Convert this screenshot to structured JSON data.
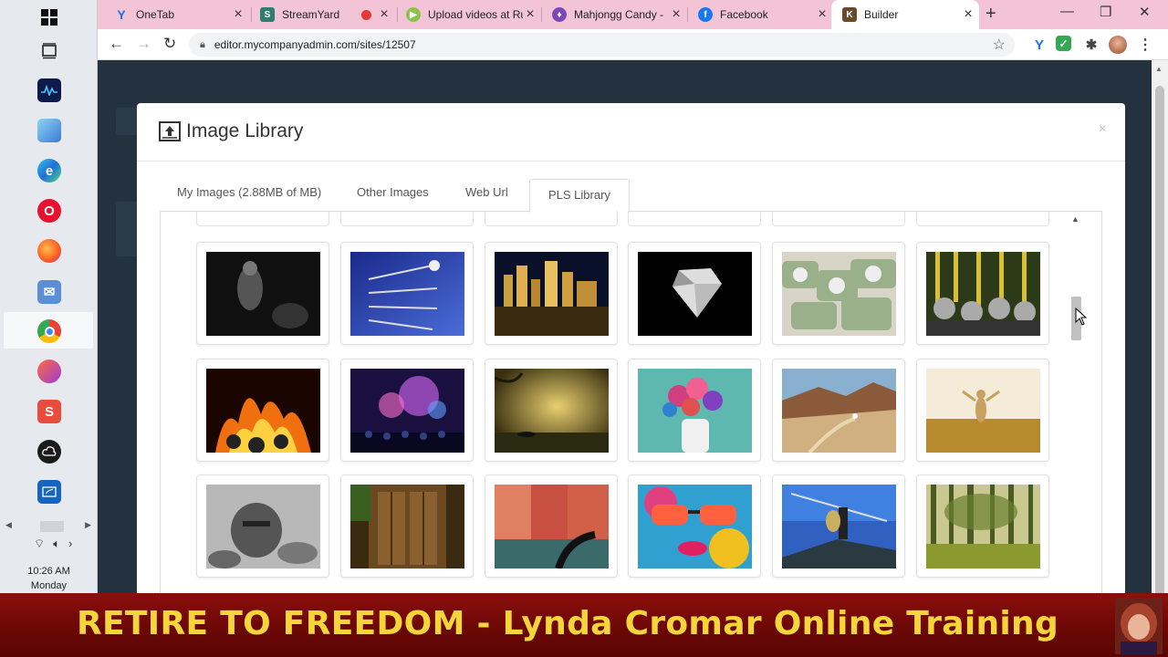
{
  "browser": {
    "tabs": [
      {
        "title": "OneTab",
        "favicon": "Y",
        "color": "#1a73e8"
      },
      {
        "title": "StreamYard",
        "favicon": "S",
        "color": "#2e7d6f"
      },
      {
        "title": "Upload videos at Ru",
        "favicon": "▶",
        "color": "#8bc34a"
      },
      {
        "title": "Mahjongg Candy - ",
        "favicon": "♦",
        "color": "#7b4ab7"
      },
      {
        "title": "Facebook",
        "favicon": "f",
        "color": "#1877f2"
      },
      {
        "title": "Builder",
        "favicon": "K",
        "color": "#6a4a2a"
      }
    ],
    "url": "editor.mycompanyadmin.com/sites/12507"
  },
  "taskbar": {
    "time": "10:26 AM",
    "day": "Monday"
  },
  "modal": {
    "title": "Image Library",
    "close_label": "×",
    "tabs": [
      {
        "label": "My Images (2.88MB of MB)",
        "active": false
      },
      {
        "label": "Other Images",
        "active": false
      },
      {
        "label": "Web Url",
        "active": false
      },
      {
        "label": "PLS Library",
        "active": true
      }
    ],
    "images": [
      {
        "name": "man-on-motorcycle-dark"
      },
      {
        "name": "darts-in-target-blue"
      },
      {
        "name": "city-skyline-night"
      },
      {
        "name": "diamond-on-black"
      },
      {
        "name": "rolled-dollar-bills"
      },
      {
        "name": "helmets-and-bamboo"
      },
      {
        "name": "fire-flames"
      },
      {
        "name": "fireworks-crowd"
      },
      {
        "name": "misty-lake-boat"
      },
      {
        "name": "flowers-in-vase"
      },
      {
        "name": "desert-hiker"
      },
      {
        "name": "person-in-field-sunset"
      },
      {
        "name": "knight-helmet-bw"
      },
      {
        "name": "old-wooden-door"
      },
      {
        "name": "venice-canal-gondola"
      },
      {
        "name": "graffiti-sunglasses-face"
      },
      {
        "name": "warrior-with-spear"
      },
      {
        "name": "forest-sunlight"
      }
    ]
  },
  "banner": {
    "text": "RETIRE TO FREEDOM - Lynda Cromar Online Training"
  }
}
